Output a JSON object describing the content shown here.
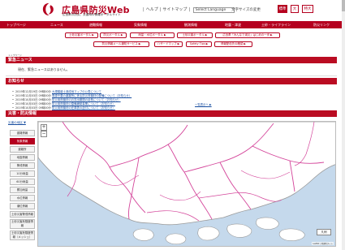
{
  "header": {
    "title": "広島県防災Web",
    "subtitle": "広島県の防災、災害時の情報ポータルサイト",
    "links": [
      "ヘルプ",
      "サイトマップ"
    ],
    "language_select": "Select Language",
    "font_size_label": "文字サイズの変更",
    "font_buttons": [
      "標準",
      "大",
      "特大"
    ]
  },
  "global_nav": [
    "トップページ",
    "ニュース",
    "避難情報",
    "気象情報",
    "観測情報",
    "地震・津波",
    "土砂・ライフライン",
    "防災リンク"
  ],
  "sub_nav": [
    [
      "土砂災害ポータル",
      "防災ポータル",
      "雨量・水位ポータル",
      "土砂災害ポータル",
      "広島県「みんなで減災」はじめの一歩"
    ],
    [
      "防災情報メール通知サービス",
      "ハザードマップ",
      "Safety Tips",
      "情報配信先の確認"
    ]
  ],
  "breadcrumb": "トップページ",
  "emergency": {
    "heading": "緊急ニュース",
    "text": "現在、緊急ニュースはありません。"
  },
  "notices": {
    "heading": "お知らせ",
    "items": [
      {
        "date": "2019年12月19日 09時00分",
        "text": "大規模盛土造成地マップの公表について"
      },
      {
        "date": "2019年12月03日 09時00分",
        "text": "電源不要の避難所に係る防災資機材の配備について（お知らせ）"
      },
      {
        "date": "2019年10月03日 09時00分",
        "text": "防災用資機材のお貸出期間の延長について（お知らせ）"
      },
      {
        "date": "2019年10月03日 09時00分",
        "text": "防災用資機材の整備補助事業について（お知らせ）"
      },
      {
        "date": "2019年10月03日 09時00分",
        "text": "防災用資機材の在庫表の送付について（お知らせ）"
      }
    ],
    "more": "一覧表示へ"
  },
  "disaster": {
    "heading": "災害・防災情報",
    "side_label": "災害の地区",
    "menu": [
      "避難情報",
      "気象情報",
      "避難所",
      "地震情報",
      "警戒情報",
      "10分雨量",
      "60分雨量",
      "累加雨量",
      "水位情報",
      "潮位情報",
      "土砂災害警戒情報",
      "土砂災害危険度情報",
      "土砂災害危険度情報（メッシュ）"
    ]
  },
  "map": {
    "legend": "凡例",
    "attribution": "Leaflet | 地理院タイル",
    "zoom_in": "+",
    "zoom_out": "−"
  },
  "colors": {
    "brand": "#b5001f",
    "sea": "#c5d9ec",
    "land": "#ffffff",
    "boundary": "#d4459a"
  }
}
